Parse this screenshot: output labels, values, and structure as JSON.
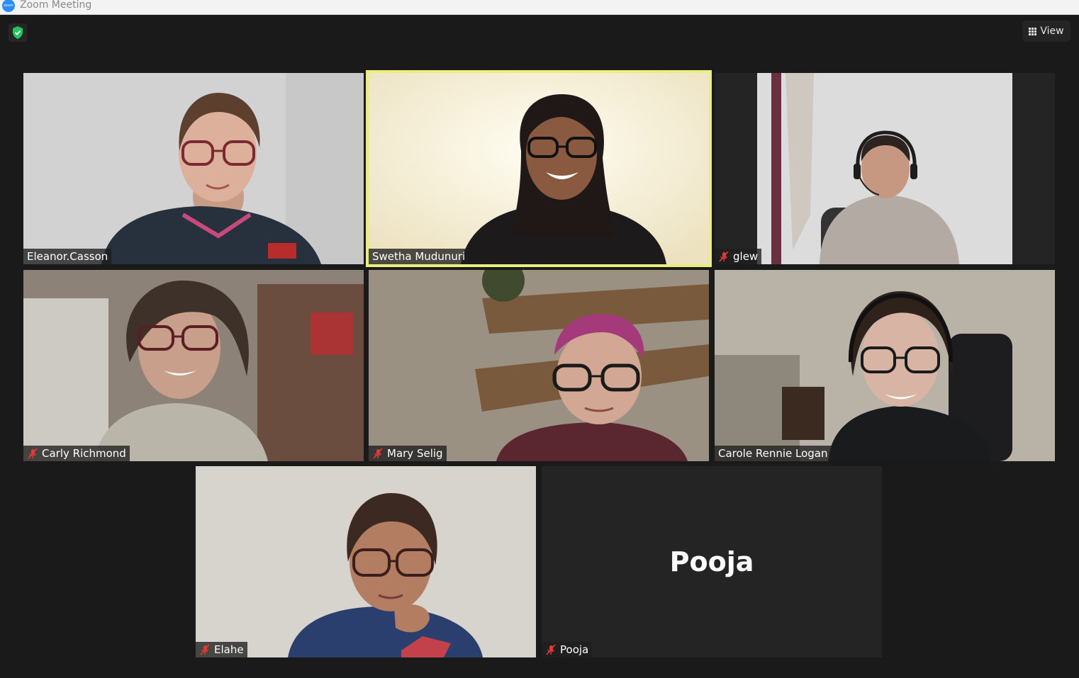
{
  "window": {
    "title": "Zoom Meeting",
    "app_icon_text": "zoom"
  },
  "toolbar": {
    "view_label": "View"
  },
  "participants": [
    {
      "name": "Eleanor.Casson",
      "muted": false,
      "video": true,
      "active_speaker": false
    },
    {
      "name": "Swetha Mudunuri",
      "muted": false,
      "video": true,
      "active_speaker": true
    },
    {
      "name": "glew",
      "muted": true,
      "video": true,
      "active_speaker": false
    },
    {
      "name": "Carly Richmond",
      "muted": true,
      "video": true,
      "active_speaker": false
    },
    {
      "name": "Mary Selig",
      "muted": true,
      "video": true,
      "active_speaker": false
    },
    {
      "name": "Carole Rennie Logan",
      "muted": false,
      "video": true,
      "active_speaker": false
    },
    {
      "name": "Elahe",
      "muted": true,
      "video": true,
      "active_speaker": false
    },
    {
      "name": "Pooja",
      "muted": true,
      "video": false,
      "active_speaker": false
    }
  ],
  "video_off_display_name": "Pooja",
  "colors": {
    "active_speaker_border": "#e9ef7e",
    "muted_mic": "#e53935",
    "security_shield": "#22c55e",
    "background": "#1a1a1a"
  },
  "icons": [
    "zoom-app-icon",
    "security-shield-icon",
    "grid-view-icon",
    "muted-microphone-icon"
  ]
}
